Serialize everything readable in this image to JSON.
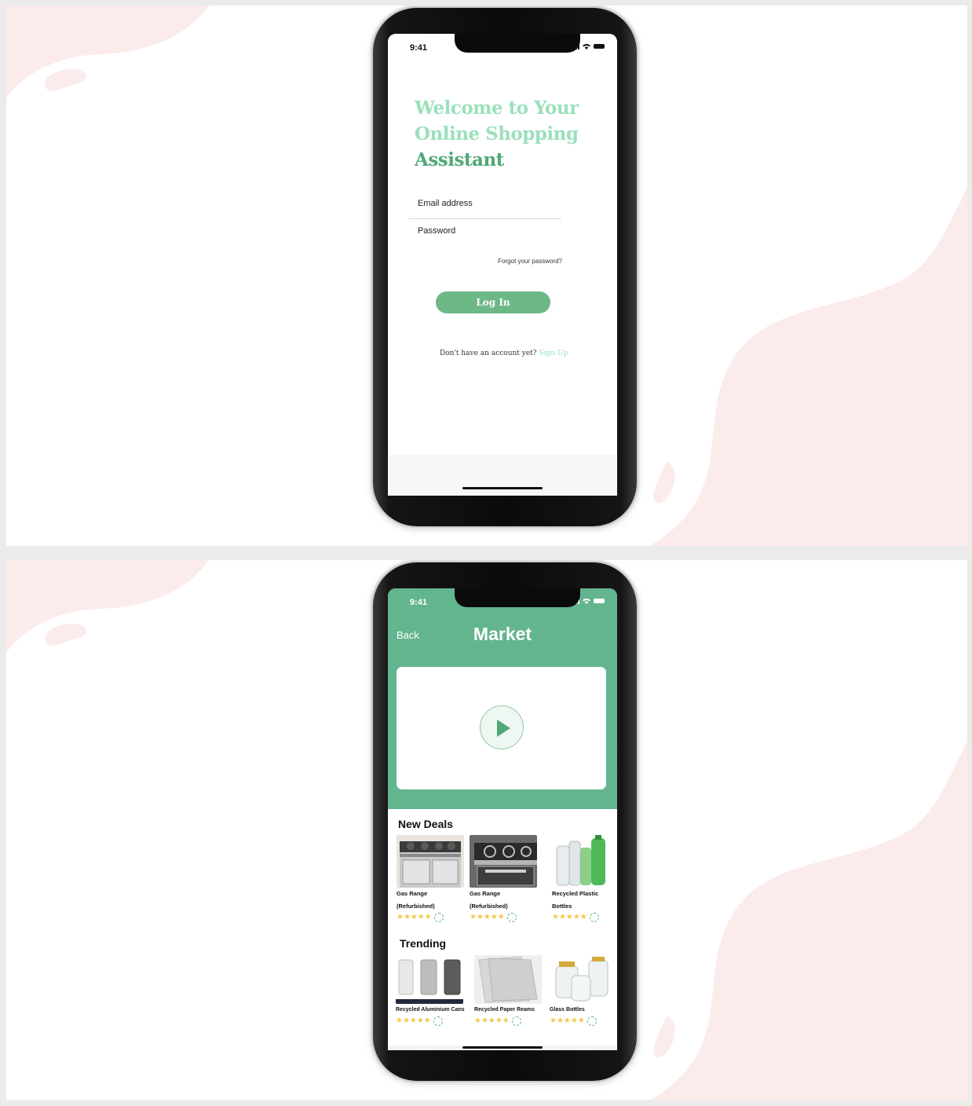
{
  "status": {
    "time": "9:41"
  },
  "login": {
    "heading_light": "Welcome to Your Online Shopping",
    "heading_strong": "Assistant",
    "email_label": "Email address",
    "password_label": "Password",
    "forgot": "Forgot your password?",
    "login_button": "Log In",
    "no_account": "Don't have an account yet?",
    "signup_link": "Sign Up"
  },
  "market": {
    "back": "Back",
    "title": "Market",
    "new_deals": {
      "title": "New Deals",
      "items": [
        {
          "label": "Gas Range (Refurbished)",
          "image": "gas-range-image"
        },
        {
          "label": "Gas Range (Refurbished)",
          "image": "gas-range-image"
        },
        {
          "label": "Recycled Plastic Bottles",
          "image": "plastic-bottles-image"
        }
      ]
    },
    "trending": {
      "title": "Trending",
      "items": [
        {
          "label": "Recycled Aluminium Cans",
          "image": "aluminium-cans-image"
        },
        {
          "label": "Recycled Paper Reams",
          "image": "paper-reams-image"
        },
        {
          "label": "Glass Bottles",
          "image": "glass-bottles-image"
        }
      ]
    },
    "rating_stars": 5
  },
  "colors": {
    "accent": "#63b58f",
    "accent_light": "#9be0bb",
    "button": "#6db887",
    "blob": "#fcebeb",
    "star": "#f2c94c"
  }
}
